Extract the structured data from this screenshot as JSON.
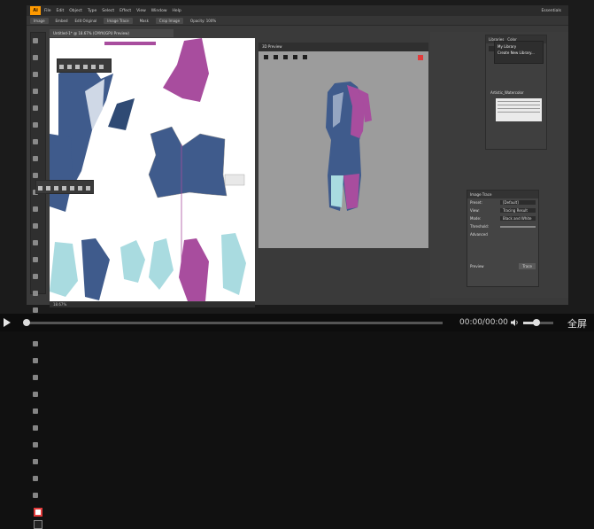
{
  "app": {
    "logo": "Ai",
    "menu": [
      "File",
      "Edit",
      "Object",
      "Type",
      "Select",
      "Effect",
      "View",
      "Window",
      "Help"
    ],
    "workspace": "Essentials"
  },
  "controlbar": {
    "items": [
      "Image",
      "Embed",
      "Edit Original",
      "Image Trace",
      "Mask",
      "Crop Image",
      "Opacity: 100%"
    ]
  },
  "document": {
    "tab_title": "Untitled-1* @ 18.67% (CMYK/GPU Preview)",
    "status_zoom": "18.67%"
  },
  "viewer": {
    "title": "3D Preview"
  },
  "libraries": {
    "tabs": [
      "Libraries",
      "Color"
    ],
    "menu_items": [
      "My Library",
      "Create New Library..."
    ],
    "brushes_label": "Artistic_Watercolor"
  },
  "image_trace": {
    "title": "Image Trace",
    "preset_label": "Preset:",
    "preset_value": "[Default]",
    "view_label": "View:",
    "view_value": "Tracing Result",
    "mode_label": "Mode:",
    "mode_value": "Black and White",
    "threshold_label": "Threshold:",
    "advanced_label": "Advanced",
    "preview_label": "Preview",
    "trace_button": "Trace"
  },
  "player": {
    "time": "00:00/00:00",
    "fullscreen_label": "全屏",
    "progress": 0.0,
    "volume": 0.45
  },
  "colors": {
    "navy": "#3f5b8c",
    "magenta": "#a84d9e",
    "aqua": "#a9dbe0",
    "artboard": "#ffffff"
  }
}
